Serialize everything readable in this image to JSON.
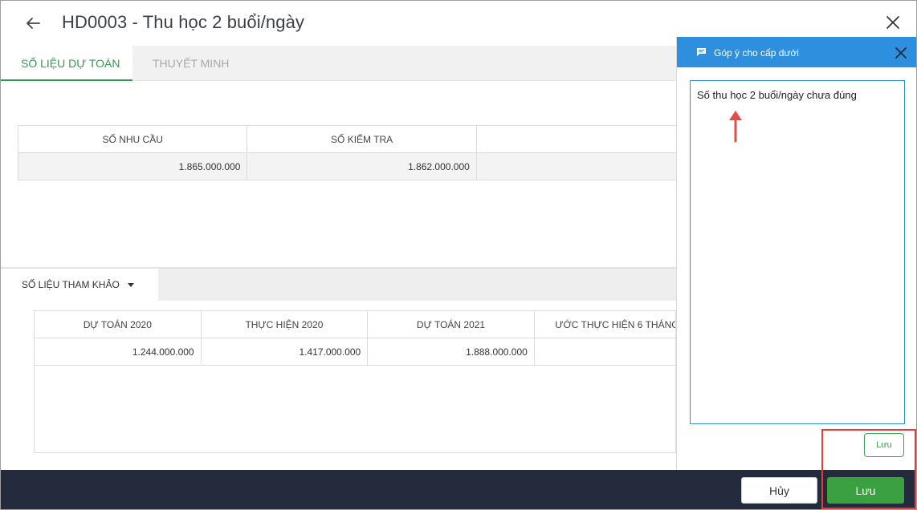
{
  "header": {
    "title": "HD0003 - Thu học 2 buổi/ngày"
  },
  "tabs": [
    {
      "label": "SỐ LIỆU DỰ TOÁN",
      "active": true
    },
    {
      "label": "THUYẾT MINH",
      "active": false
    }
  ],
  "main_table": {
    "headers": [
      "SỐ NHU CẦU",
      "SỐ KIỂM TRA"
    ],
    "row": [
      "1.865.000.000",
      "1.862.000.000"
    ]
  },
  "reference": {
    "tab_label": "SỐ LIỆU THAM KHẢO",
    "headers": [
      "DỰ TOÁN 2020",
      "THỰC HIỆN 2020",
      "DỰ TOÁN 2021",
      "ƯỚC THỰC HIỆN 6 THÁNG"
    ],
    "row": [
      "1.244.000.000",
      "1.417.000.000",
      "1.888.000.000",
      ""
    ]
  },
  "panel": {
    "title": "Góp ý cho cấp dưới",
    "comment_text": "Số thu học 2 buổi/ngày chưa đúng",
    "save_label": "Lưu",
    "header_color": "#2e8fde"
  },
  "footer": {
    "cancel_label": "Hủy",
    "save_label": "Lưu"
  },
  "colors": {
    "accent_green": "#2e9e4d",
    "footer_bg": "#232b3d",
    "highlight_red": "#e83a3a"
  }
}
